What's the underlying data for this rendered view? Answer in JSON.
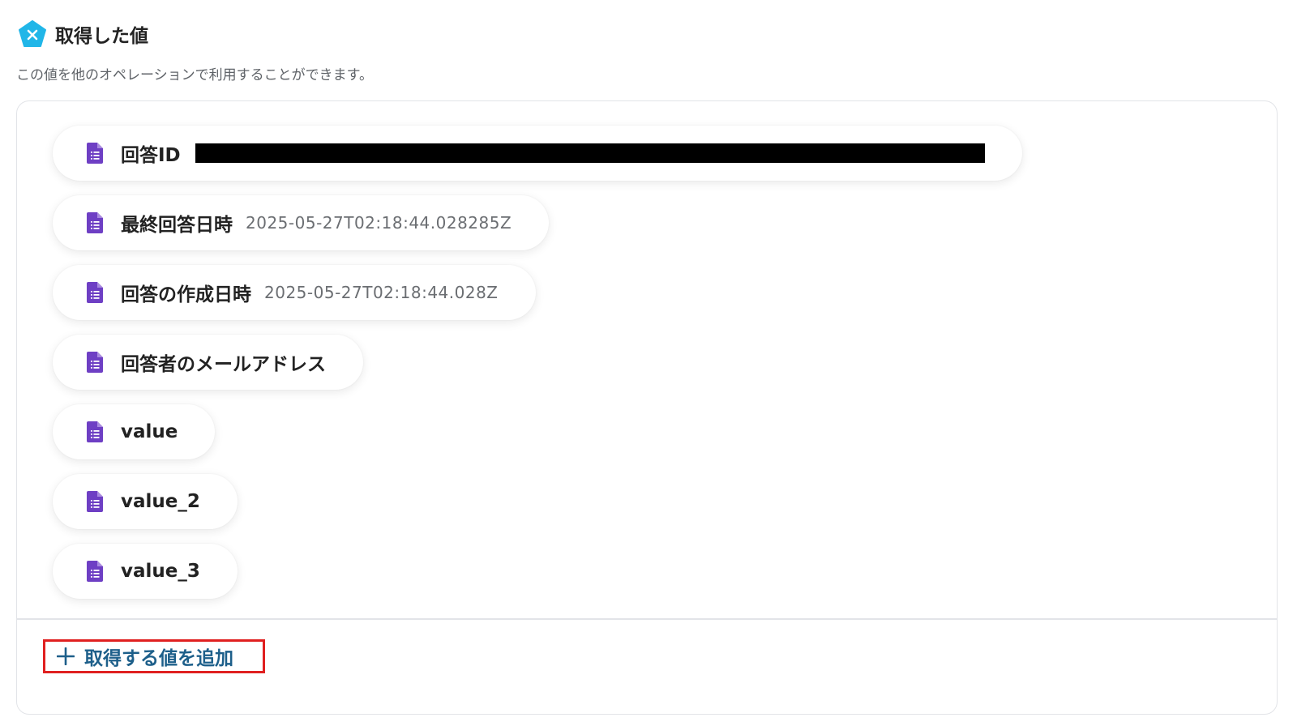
{
  "header": {
    "icon": "yoom-x-pentagon-icon",
    "title": "取得した値",
    "description": "この値を他のオペレーションで利用することができます。"
  },
  "colors": {
    "logo": "#21b6e8",
    "doc_icon": "#6e3fc4",
    "add_label": "#1d5f8a",
    "highlight_border": "#e02020"
  },
  "values": [
    {
      "label": "回答ID",
      "value": "",
      "redacted": true,
      "icon": "google-forms-doc-icon"
    },
    {
      "label": "最終回答日時",
      "value": "2025-05-27T02:18:44.028285Z",
      "icon": "google-forms-doc-icon"
    },
    {
      "label": "回答の作成日時",
      "value": "2025-05-27T02:18:44.028Z",
      "icon": "google-forms-doc-icon"
    },
    {
      "label": "回答者のメールアドレス",
      "value": "",
      "icon": "google-forms-doc-icon"
    },
    {
      "label": "value",
      "value": "",
      "icon": "google-forms-doc-icon"
    },
    {
      "label": "value_2",
      "value": "",
      "icon": "google-forms-doc-icon"
    },
    {
      "label": "value_3",
      "value": "",
      "icon": "google-forms-doc-icon"
    }
  ],
  "add_button": {
    "icon": "plus-icon",
    "label": "取得する値を追加"
  }
}
